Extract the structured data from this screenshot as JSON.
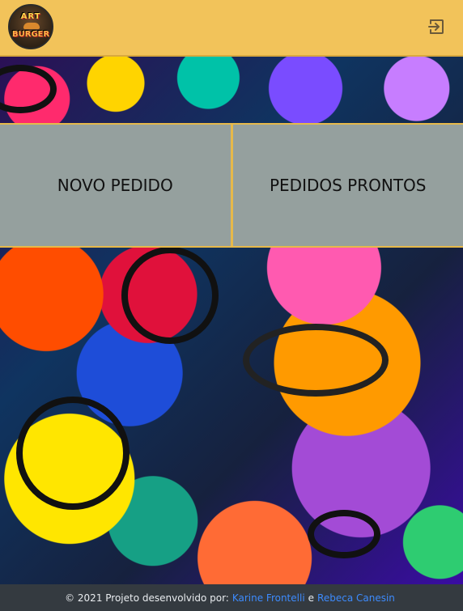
{
  "header": {
    "logo": {
      "line1": "ART",
      "line2": "BURGER"
    },
    "exit_icon": "logout-icon"
  },
  "menu": {
    "new_order_label": "NOVO PEDIDO",
    "ready_orders_label": "PEDIDOS PRONTOS"
  },
  "footer": {
    "text": "© 2021 Projeto desenvolvido por:",
    "author1": "Karine Frontelli",
    "conjunction": "e",
    "author2": "Rebeca Canesin"
  },
  "colors": {
    "header_bg": "#f2c35a",
    "button_bg": "#95a09e",
    "button_border": "#e6b94a",
    "footer_bg": "#343a40",
    "link": "#3d8bfd"
  }
}
